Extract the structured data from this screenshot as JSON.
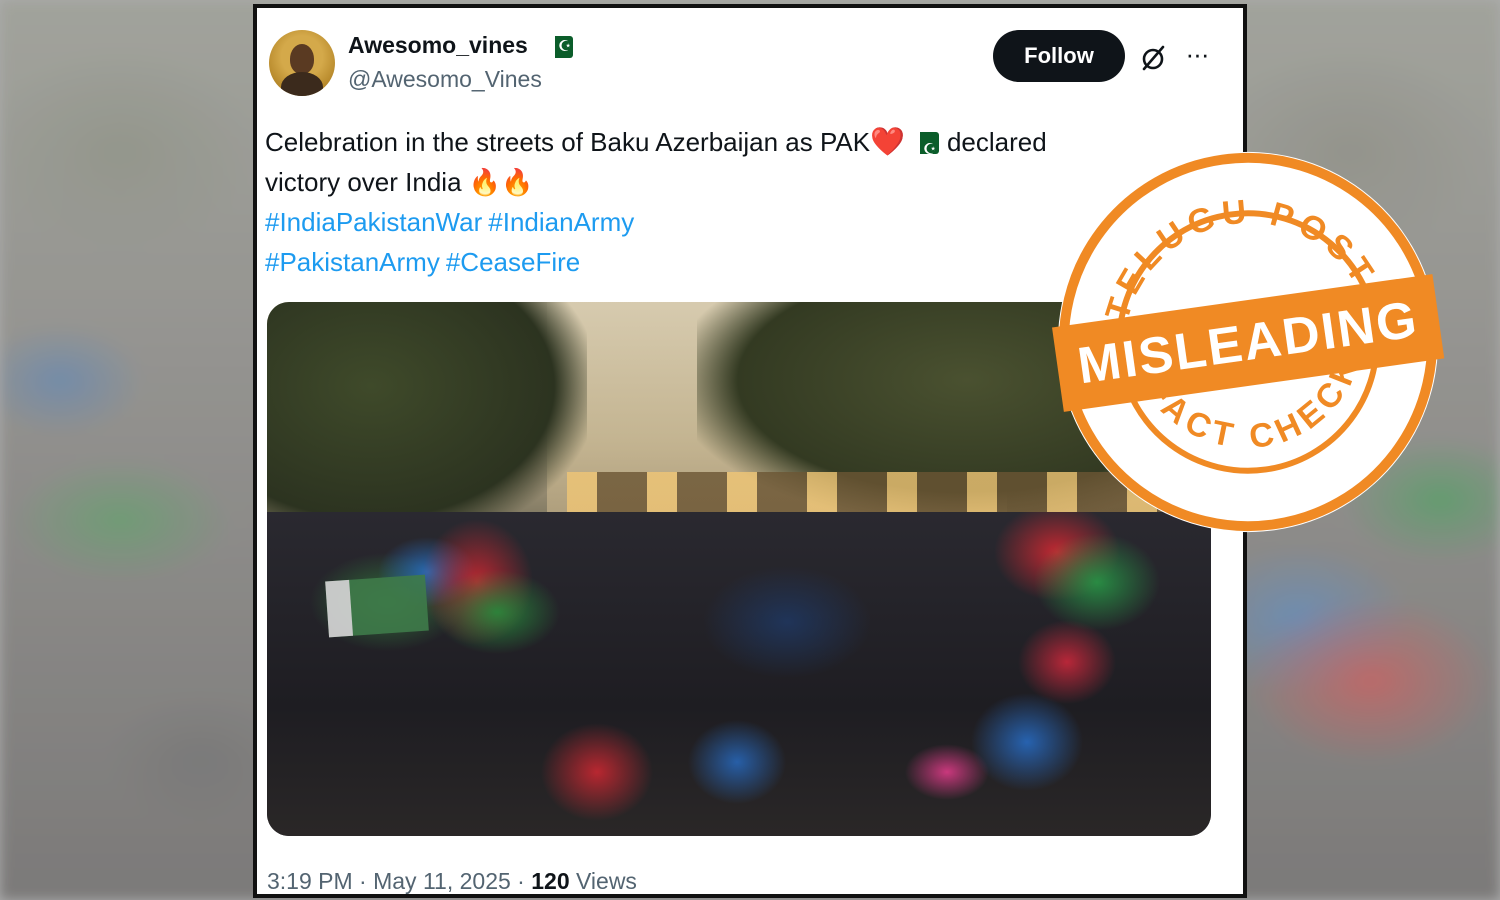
{
  "tweet": {
    "display_name": "Awesomo_vines",
    "handle": "@Awesomo_Vines",
    "follow_label": "Follow",
    "more_label": "···",
    "text_part1": "Celebration in the streets of Baku Azerbaijan  as PAK",
    "heart": "❤️",
    "text_part2": "declared",
    "text_line2": "victory over India ",
    "fire": "🔥🔥",
    "hashtags_line1": [
      "#IndiaPakistanWar",
      "#IndianArmy"
    ],
    "hashtags_line2": [
      "#PakistanArmy",
      "#CeaseFire"
    ],
    "time": "3:19 PM",
    "date": "May 11, 2025",
    "separator": "·",
    "views_count": "120",
    "views_label": "Views"
  },
  "stamp": {
    "top_text": "TELUGU POST",
    "verdict": "MISLEADING",
    "bottom_text": "FACT CHECK",
    "color": "#f08a24"
  },
  "colors": {
    "link": "#1d9bf0",
    "text": "#0f1419",
    "muted": "#536471"
  }
}
